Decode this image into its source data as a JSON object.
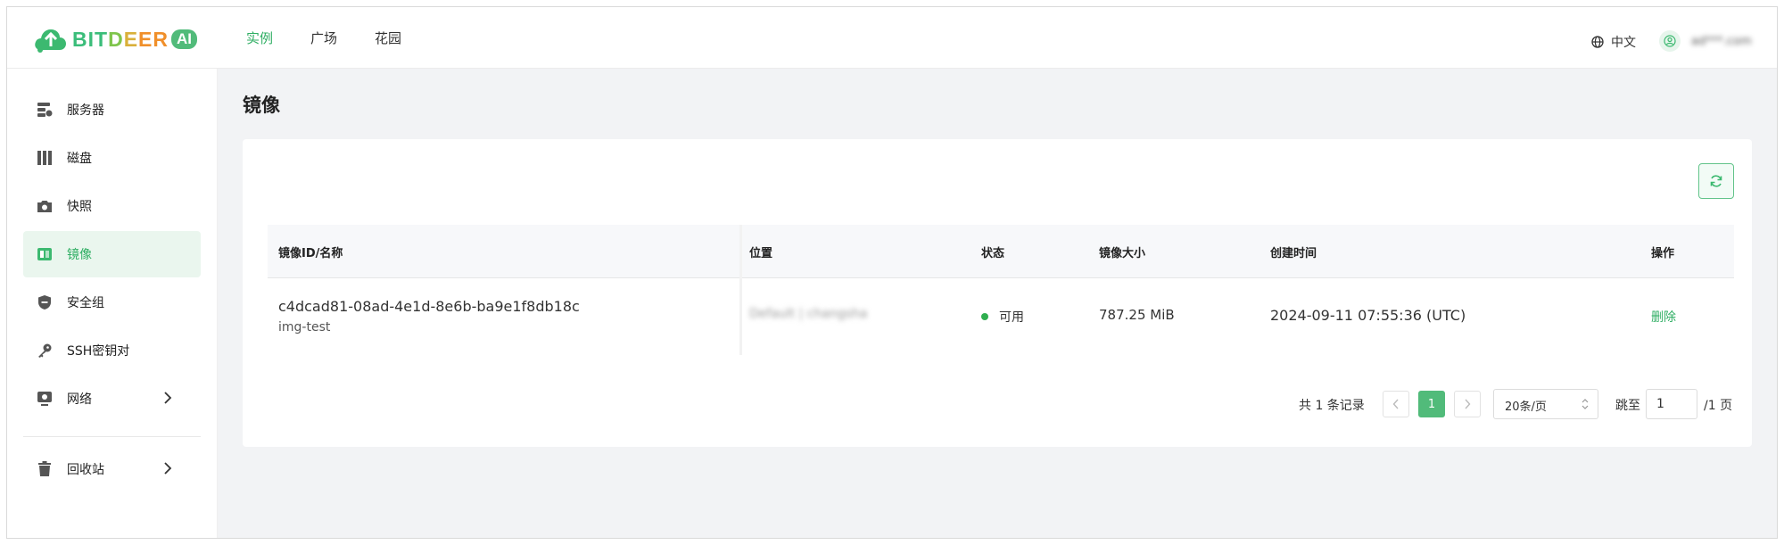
{
  "brand": {
    "name_parts": [
      "BIT",
      "D",
      "E",
      "ER"
    ],
    "badge": "AI"
  },
  "topnav": [
    {
      "label": "实例",
      "active": true
    },
    {
      "label": "广场",
      "active": false
    },
    {
      "label": "花园",
      "active": false
    }
  ],
  "header": {
    "language": "中文",
    "username": "ad***.com"
  },
  "sidebar": {
    "items": [
      {
        "label": "服务器",
        "icon": "server-icon",
        "active": false
      },
      {
        "label": "磁盘",
        "icon": "disk-icon",
        "active": false
      },
      {
        "label": "快照",
        "icon": "camera-icon",
        "active": false
      },
      {
        "label": "镜像",
        "icon": "image-icon",
        "active": true
      },
      {
        "label": "安全组",
        "icon": "shield-icon",
        "active": false
      },
      {
        "label": "SSH密钥对",
        "icon": "key-icon",
        "active": false
      },
      {
        "label": "网络",
        "icon": "network-icon",
        "active": false,
        "expandable": true
      },
      {
        "label": "回收站",
        "icon": "trash-icon",
        "active": false,
        "expandable": true
      }
    ]
  },
  "page": {
    "title": "镜像"
  },
  "table": {
    "headers": [
      "镜像ID/名称",
      "位置",
      "状态",
      "镜像大小",
      "创建时间",
      "操作"
    ],
    "rows": [
      {
        "id": "c4dcad81-08ad-4e1d-8e6b-ba9e1f8db18c",
        "name": "img-test",
        "location": "Default | changsha",
        "status": "可用",
        "size": "787.25 MiB",
        "created": "2024-09-11 07:55:36 (UTC)",
        "action": "删除"
      }
    ]
  },
  "pagination": {
    "total_label": "共 1 条记录",
    "current_page": "1",
    "page_size": "20条/页",
    "goto_label": "跳至",
    "goto_value": "1",
    "pages_label": "/1 页"
  },
  "colors": {
    "accent": "#2fae63",
    "status_ok": "#2fae4f",
    "active_bg": "#eaf6ee"
  }
}
